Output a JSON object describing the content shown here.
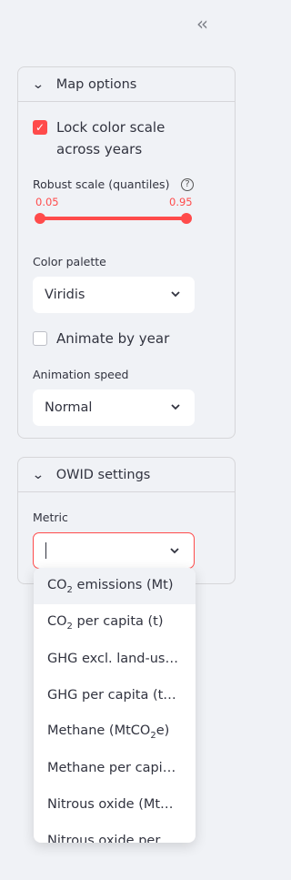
{
  "sidebar": {
    "collapse_icon": "double-chevron-left"
  },
  "map_options": {
    "title": "Map options",
    "lock_color_scale": {
      "label": "Lock color scale across years",
      "checked": true
    },
    "robust_scale": {
      "label": "Robust scale (quantiles)",
      "low": "0.05",
      "high": "0.95"
    },
    "color_palette": {
      "label": "Color palette",
      "value": "Viridis"
    },
    "animate_by_year": {
      "label": "Animate by year",
      "checked": false
    },
    "animation_speed": {
      "label": "Animation speed",
      "value": "Normal"
    }
  },
  "owid_settings": {
    "title": "OWID settings",
    "metric": {
      "label": "Metric",
      "value": "",
      "options": [
        {
          "pre": "CO",
          "sub": "2",
          "post": " emissions (Mt)"
        },
        {
          "pre": "CO",
          "sub": "2",
          "post": " per capita (t)"
        },
        {
          "pre": "GHG excl. land-us…",
          "sub": "",
          "post": ""
        },
        {
          "pre": "GHG per capita (t…",
          "sub": "",
          "post": ""
        },
        {
          "pre": "Methane (MtCO",
          "sub": "2",
          "post": "e)"
        },
        {
          "pre": "Methane per capi…",
          "sub": "",
          "post": ""
        },
        {
          "pre": "Nitrous oxide (Mt…",
          "sub": "",
          "post": ""
        },
        {
          "pre": "Nitrous oxide per…",
          "sub": "",
          "post": ""
        }
      ]
    }
  },
  "colors": {
    "accent": "#ff4b4b",
    "background": "#f0f2f6",
    "text": "#31333f"
  }
}
